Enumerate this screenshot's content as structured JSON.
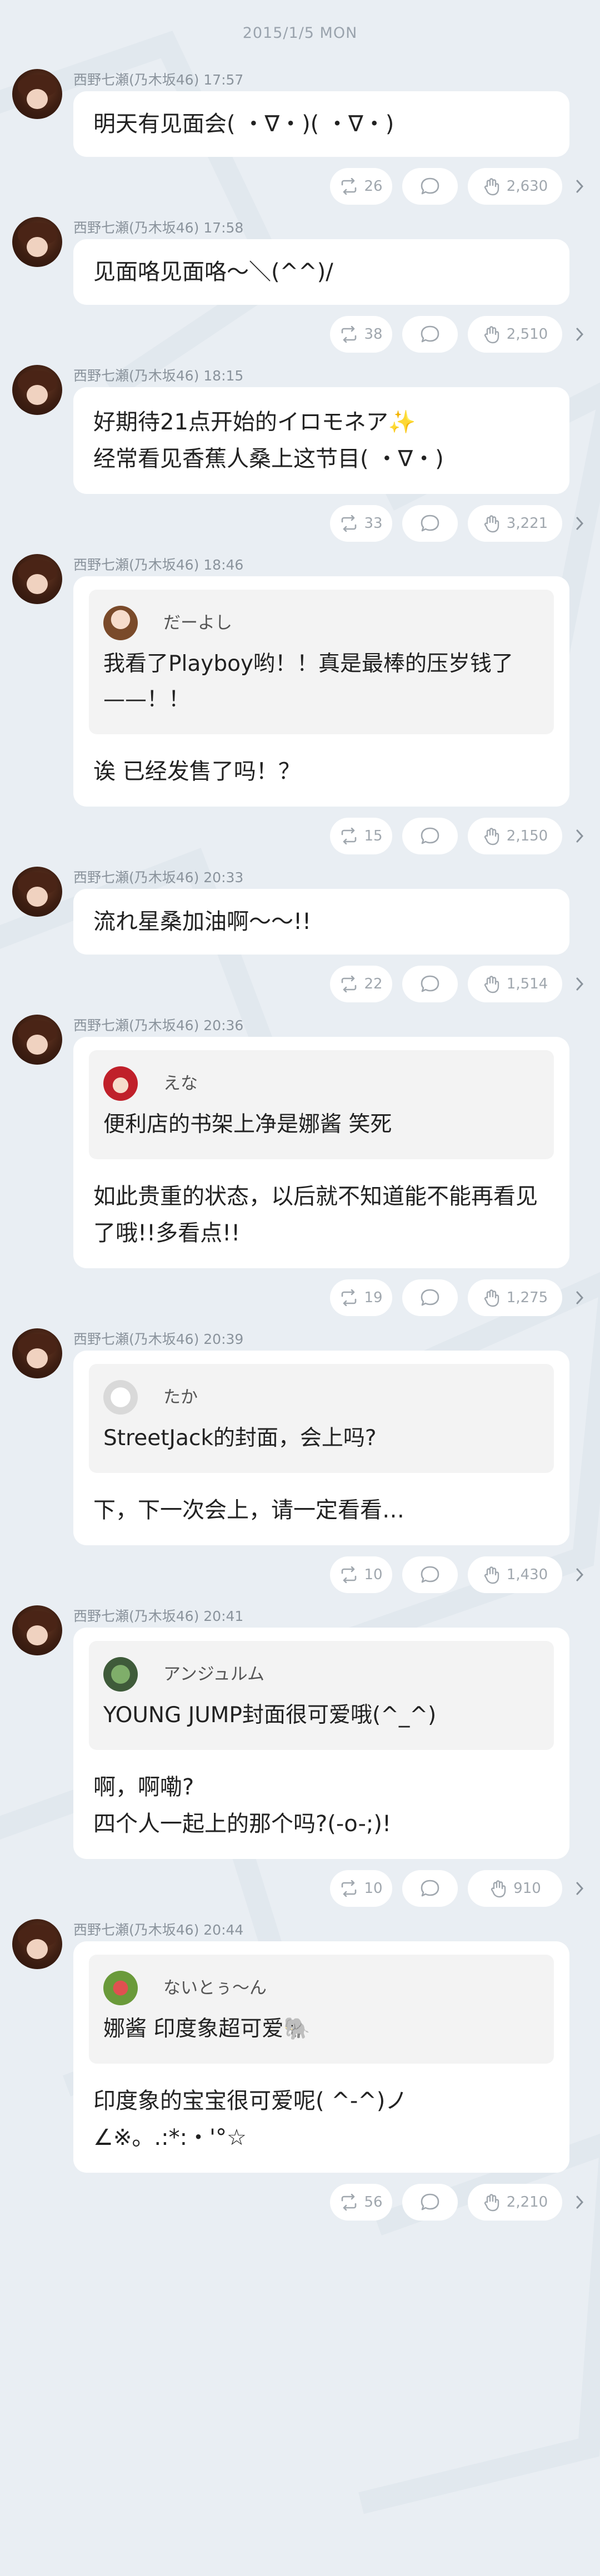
{
  "date_header": "2015/1/5 MON",
  "colors": {
    "background": "#e9eef3",
    "bubble": "#ffffff",
    "quote": "#f3f3f3",
    "meta": "#8a939c"
  },
  "posts": [
    {
      "author": "西野七瀬(乃木坂46)",
      "time": "17:57",
      "text": "明天有见面会( ・∇・)( ・∇・)",
      "retweets": "26",
      "likes": "2,630",
      "height": 120
    },
    {
      "author": "西野七瀬(乃木坂46)",
      "time": "17:58",
      "text": "见面咯见面咯～＼(^^)/",
      "retweets": "38",
      "likes": "2,510"
    },
    {
      "author": "西野七瀬(乃木坂46)",
      "time": "18:15",
      "text": "好期待21点开始的イロモネア✨\n经常看见香蕉人桑上这节目( ・∇・)\n",
      "retweets": "33",
      "likes": "3,221"
    },
    {
      "author": "西野七瀬(乃木坂46)",
      "time": "18:46",
      "quote": {
        "name": "だーよし",
        "text": "我看了Playboy哟！！真是最棒的压岁钱了——！！"
      },
      "text": "诶 已经发售了吗！？\n",
      "retweets": "15",
      "likes": "2,150"
    },
    {
      "author": "西野七瀬(乃木坂46)",
      "time": "20:33",
      "text": "流れ星桑加油啊～～!!",
      "retweets": "22",
      "likes": "1,514"
    },
    {
      "author": "西野七瀬(乃木坂46)",
      "time": "20:36",
      "quote": {
        "name": "えな",
        "text": "便利店的书架上净是娜酱 笑死\n"
      },
      "text": "如此贵重的状态，以后就不知道能不能再看见了哦!!多看点!!",
      "retweets": "19",
      "likes": "1,275"
    },
    {
      "author": "西野七瀬(乃木坂46)",
      "time": "20:39",
      "quote": {
        "name": "たか",
        "text": "StreetJack的封面，会上吗?\n"
      },
      "text": "下，下一次会上，请一定看看…\n",
      "retweets": "10",
      "likes": "1,430"
    },
    {
      "author": "西野七瀬(乃木坂46)",
      "time": "20:41",
      "quote": {
        "name": "アンジュルム",
        "text": "YOUNG JUMP封面很可爱哦(^_^)"
      },
      "text": "啊，啊嘞?\n四个人一起上的那个吗?(-o-;)!",
      "retweets": "10",
      "likes": "910"
    },
    {
      "author": "西野七瀬(乃木坂46)",
      "time": "20:44",
      "quote": {
        "name": "ないとぅ〜ん",
        "text": "娜酱 印度象超可爱🐘"
      },
      "text": "印度象的宝宝很可爱呢( ^-^)ノ\n∠※。.:*:・'°☆",
      "retweets": "56",
      "likes": "2,210"
    }
  ],
  "icons": {
    "retweet": "retweet-icon",
    "comment": "comment-icon",
    "like": "clap-icon",
    "more": "chevron-right-icon"
  }
}
